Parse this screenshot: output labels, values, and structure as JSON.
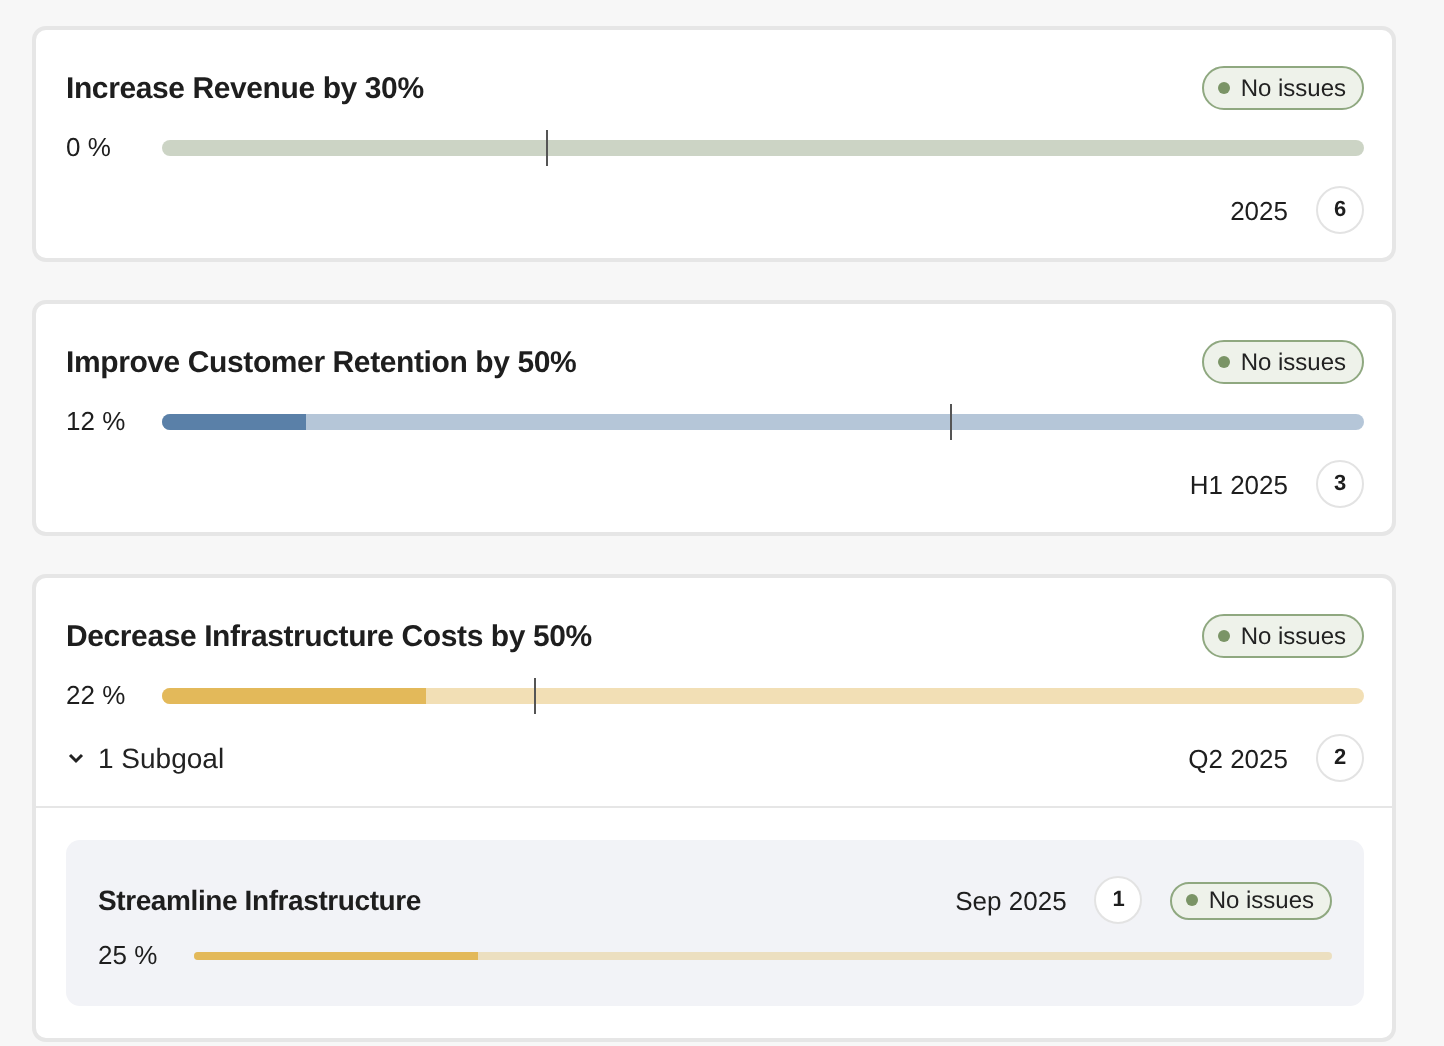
{
  "goals": [
    {
      "title": "Increase Revenue by 30%",
      "status": "No issues",
      "percent": "0 %",
      "progress": {
        "level": 0
      },
      "target": {
        "level": 0.32
      },
      "color": "#8fa07e",
      "period": "2025",
      "count": "6"
    },
    {
      "title": "Improve Customer Retention by 50%",
      "status": "No issues",
      "percent": "12 %",
      "progress": {
        "level": 0.12
      },
      "target": {
        "level": 0.656
      },
      "color": "#5a80a8",
      "period": "H1 2025",
      "count": "3"
    },
    {
      "title": "Decrease Infrastructure Costs by 50%",
      "status": "No issues",
      "percent": "22 %",
      "progress": {
        "level": 0.22
      },
      "target": {
        "level": 0.31
      },
      "color": "#e3b95a",
      "period": "Q2 2025",
      "count": "2",
      "subgoals_toggle": {
        "label": "1 Subgoal",
        "expanded": true
      },
      "subgoals": [
        {
          "title": "Streamline Infrastructure",
          "period": "Sep 2025",
          "count": "1",
          "status": "No issues",
          "percent": "25 %",
          "progress": {
            "level": 0.25
          }
        }
      ]
    }
  ]
}
